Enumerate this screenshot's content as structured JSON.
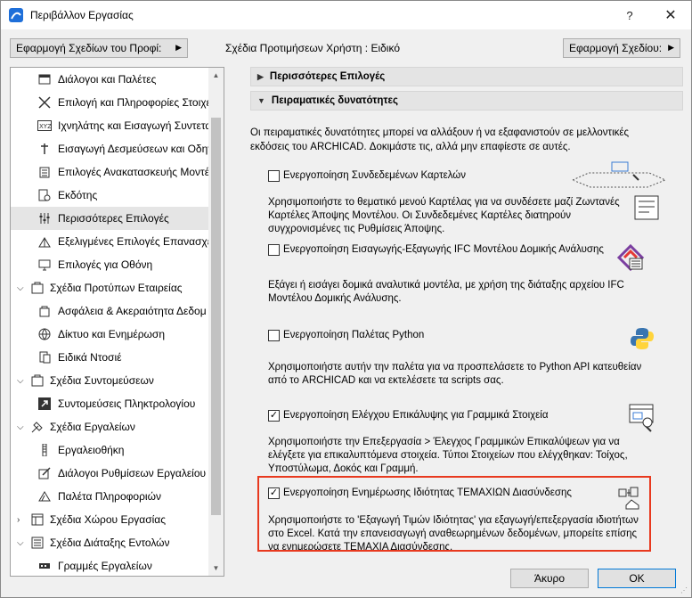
{
  "window": {
    "title": "Περιβάλλον Εργασίας",
    "help": "?",
    "close": "✕"
  },
  "toolbar": {
    "profile_button": "Εφαρμογή Σχεδίων του Προφί:",
    "scheme_label": "Σχέδια Προτιμήσεων Χρήστη : Ειδικό",
    "dialog_button": "Εφαρμογή Σχεδίου:"
  },
  "sidebar": {
    "items": [
      {
        "label": "Διάλογοι και Παλέτες",
        "icon": "palettes-icon"
      },
      {
        "label": "Επιλογή και Πληροφορίες Στοιχε",
        "icon": "selection-icon"
      },
      {
        "label": "Ιχνηλάτης και Εισαγωγή Συντεταγ",
        "icon": "tracker-icon"
      },
      {
        "label": "Εισαγωγή Δεσμεύσεων και Οδηγ",
        "icon": "guides-icon"
      },
      {
        "label": "Επιλογές Ανακατασκευής Μοντέλ",
        "icon": "rebuild-icon"
      },
      {
        "label": "Εκδότης",
        "icon": "publisher-icon"
      },
      {
        "label": "Περισσότερες Επιλογές",
        "icon": "more-options-icon"
      },
      {
        "label": "Εξελιγμένες Επιλογές Επανασχεδί",
        "icon": "redraw-icon"
      },
      {
        "label": "Επιλογές για Οθόνη",
        "icon": "screen-icon"
      },
      {
        "label": "Σχέδια Προτύπων Εταιρείας",
        "icon": "company-icon"
      },
      {
        "label": "Ασφάλεια & Ακεραιότητα Δεδομ",
        "icon": "safety-icon"
      },
      {
        "label": "Δίκτυο και Ενημέρωση",
        "icon": "network-icon"
      },
      {
        "label": "Ειδικά Ντοσιέ",
        "icon": "folder-icon"
      },
      {
        "label": "Σχέδια Συντομεύσεων",
        "icon": "shortcut-schemes-icon"
      },
      {
        "label": "Συντομεύσεις Πληκτρολογίου",
        "icon": "keyboard-icon"
      },
      {
        "label": "Σχέδια Εργαλείων",
        "icon": "tool-schemes-icon"
      },
      {
        "label": "Εργαλειοθήκη",
        "icon": "toolbox-icon"
      },
      {
        "label": "Διάλογοι Ρυθμίσεων Εργαλείου",
        "icon": "tool-settings-icon"
      },
      {
        "label": "Παλέτα Πληροφοριών",
        "icon": "info-palette-icon"
      },
      {
        "label": "Σχέδια Χώρου Εργασίας",
        "icon": "workspace-icon"
      },
      {
        "label": "Σχέδια Διάταξης Εντολών",
        "icon": "command-layout-icon"
      },
      {
        "label": "Γραμμές Εργαλείων",
        "icon": "toolbars-icon"
      }
    ]
  },
  "panel": {
    "section_more": "Περισσότερες Επιλογές",
    "section_experimental": "Πειραματικές δυνατότητες",
    "intro": "Οι πειραματικές δυνατότητες μπορεί να αλλάξουν ή να εξαφανιστούν σε μελλοντικές εκδόσεις του ARCHICAD. Δοκιμάστε τις, αλλά μην επαφίεστε σε αυτές.",
    "options": [
      {
        "title": "Ενεργοποίηση Συνδεδεμένων Καρτελών",
        "checked": false,
        "mark": "",
        "desc": "Χρησιμοποιήστε το θεματικό μενού Καρτέλας για να συνδέσετε μαζί Ζωντανές Καρτέλες Άποψης Μοντέλου. Οι Συνδεδεμένες Καρτέλες διατηρούν συγχρονισμένες τις Ρυθμίσεις Άποψης."
      },
      {
        "title": "Ενεργοποίηση Εισαγωγής-Εξαγωγής IFC Μοντέλου Δομικής Ανάλυσης",
        "checked": false,
        "mark": "",
        "desc": "Εξάγει ή εισάγει δομικά αναλυτικά μοντέλα, με χρήση της διάταξης αρχείου IFC Μοντέλου Δομικής Ανάλυσης."
      },
      {
        "title": "Ενεργοποίηση Παλέτας Python",
        "checked": false,
        "mark": "",
        "desc": "Χρησιμοποιήστε αυτήν την παλέτα για να προσπελάσετε το Python API κατευθείαν από το ARCHICAD και να εκτελέσετε τα scripts σας."
      },
      {
        "title": "Ενεργοποίηση Ελέγχου Επικάλυψης για Γραμμικά Στοιχεία",
        "checked": true,
        "mark": "✓",
        "desc": "Χρησιμοποιήστε την Επεξεργασία > Έλεγχος Γραμμικών Επικαλύψεων για να ελέγξετε για επικαλυπτόμενα στοιχεία. Τύποι Στοιχείων που ελέγχθηκαν: Τοίχος, Υποστύλωμα, Δοκός και Γραμμή."
      },
      {
        "title": "Ενεργοποίηση Ενημέρωσης Ιδιότητας ΤΕΜΑΧΙΩΝ Διασύνδεσης",
        "checked": true,
        "mark": "✓",
        "desc": "Χρησιμοποιήστε το 'Εξαγωγή Τιμών Ιδιότητας' για εξαγωγή/επεξεργασία ιδιοτήτων στο Excel. Κατά την επανεισαγωγή αναθεωρημένων δεδομένων, μπορείτε επίσης να ενημερώσετε ΤΕΜΑΧΙΑ Διασύνδεσης."
      }
    ]
  },
  "footer": {
    "cancel": "Άκυρο",
    "ok": "OK"
  },
  "colors": {
    "highlight": "#e8391e",
    "selected_row": "#e5e5e5"
  }
}
